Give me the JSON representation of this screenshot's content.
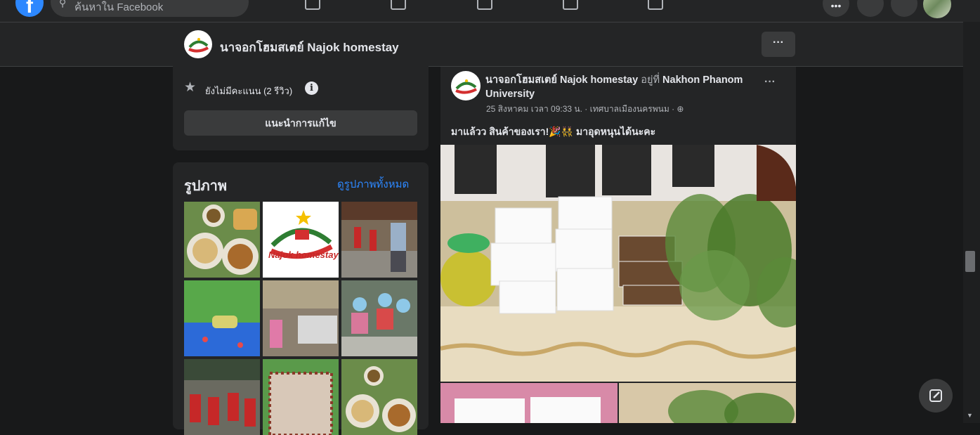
{
  "topnav": {
    "logo_letter": "f",
    "search_placeholder": "ค้นหาใน Facebook"
  },
  "page_header": {
    "title": "นาจอกโฮมสเตย์ Najok homestay",
    "more_label": "···"
  },
  "intro": {
    "rating_text": "ยังไม่มีคะแนน (2 รีวิว)",
    "info_glyph": "i",
    "suggest_edit_label": "แนะนำการแก้ไข"
  },
  "photos": {
    "title": "รูปภาพ",
    "see_all_label": "ดูรูปภาพทั้งหมด",
    "logo_caption": "Najok homestay"
  },
  "post": {
    "author": "นาจอกโฮมสเตย์ Najok homestay",
    "at_word": "อยู่ที่",
    "location": "Nakhon Phanom University",
    "meta": "25 สิงหาคม เวลา 09:33 น. · เทศบาลเมืองนครพนม ·",
    "text": "มาแล้วว สินค้าของเรา!🎉👯 มาอุดหนุนได้นะคะ",
    "more_label": "···"
  },
  "colors": {
    "background": "#18191a",
    "surface": "#242526",
    "link": "#2d88ff",
    "text": "#e4e6eb",
    "muted": "#b0b3b8"
  }
}
